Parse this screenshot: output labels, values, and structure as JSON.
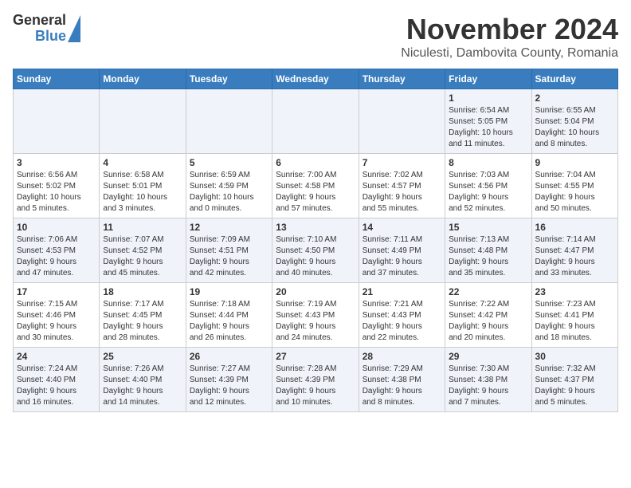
{
  "header": {
    "logo_general": "General",
    "logo_blue": "Blue",
    "title": "November 2024",
    "subtitle": "Niculesti, Dambovita County, Romania"
  },
  "weekdays": [
    "Sunday",
    "Monday",
    "Tuesday",
    "Wednesday",
    "Thursday",
    "Friday",
    "Saturday"
  ],
  "weeks": [
    [
      {
        "day": "",
        "info": ""
      },
      {
        "day": "",
        "info": ""
      },
      {
        "day": "",
        "info": ""
      },
      {
        "day": "",
        "info": ""
      },
      {
        "day": "",
        "info": ""
      },
      {
        "day": "1",
        "info": "Sunrise: 6:54 AM\nSunset: 5:05 PM\nDaylight: 10 hours\nand 11 minutes."
      },
      {
        "day": "2",
        "info": "Sunrise: 6:55 AM\nSunset: 5:04 PM\nDaylight: 10 hours\nand 8 minutes."
      }
    ],
    [
      {
        "day": "3",
        "info": "Sunrise: 6:56 AM\nSunset: 5:02 PM\nDaylight: 10 hours\nand 5 minutes."
      },
      {
        "day": "4",
        "info": "Sunrise: 6:58 AM\nSunset: 5:01 PM\nDaylight: 10 hours\nand 3 minutes."
      },
      {
        "day": "5",
        "info": "Sunrise: 6:59 AM\nSunset: 4:59 PM\nDaylight: 10 hours\nand 0 minutes."
      },
      {
        "day": "6",
        "info": "Sunrise: 7:00 AM\nSunset: 4:58 PM\nDaylight: 9 hours\nand 57 minutes."
      },
      {
        "day": "7",
        "info": "Sunrise: 7:02 AM\nSunset: 4:57 PM\nDaylight: 9 hours\nand 55 minutes."
      },
      {
        "day": "8",
        "info": "Sunrise: 7:03 AM\nSunset: 4:56 PM\nDaylight: 9 hours\nand 52 minutes."
      },
      {
        "day": "9",
        "info": "Sunrise: 7:04 AM\nSunset: 4:55 PM\nDaylight: 9 hours\nand 50 minutes."
      }
    ],
    [
      {
        "day": "10",
        "info": "Sunrise: 7:06 AM\nSunset: 4:53 PM\nDaylight: 9 hours\nand 47 minutes."
      },
      {
        "day": "11",
        "info": "Sunrise: 7:07 AM\nSunset: 4:52 PM\nDaylight: 9 hours\nand 45 minutes."
      },
      {
        "day": "12",
        "info": "Sunrise: 7:09 AM\nSunset: 4:51 PM\nDaylight: 9 hours\nand 42 minutes."
      },
      {
        "day": "13",
        "info": "Sunrise: 7:10 AM\nSunset: 4:50 PM\nDaylight: 9 hours\nand 40 minutes."
      },
      {
        "day": "14",
        "info": "Sunrise: 7:11 AM\nSunset: 4:49 PM\nDaylight: 9 hours\nand 37 minutes."
      },
      {
        "day": "15",
        "info": "Sunrise: 7:13 AM\nSunset: 4:48 PM\nDaylight: 9 hours\nand 35 minutes."
      },
      {
        "day": "16",
        "info": "Sunrise: 7:14 AM\nSunset: 4:47 PM\nDaylight: 9 hours\nand 33 minutes."
      }
    ],
    [
      {
        "day": "17",
        "info": "Sunrise: 7:15 AM\nSunset: 4:46 PM\nDaylight: 9 hours\nand 30 minutes."
      },
      {
        "day": "18",
        "info": "Sunrise: 7:17 AM\nSunset: 4:45 PM\nDaylight: 9 hours\nand 28 minutes."
      },
      {
        "day": "19",
        "info": "Sunrise: 7:18 AM\nSunset: 4:44 PM\nDaylight: 9 hours\nand 26 minutes."
      },
      {
        "day": "20",
        "info": "Sunrise: 7:19 AM\nSunset: 4:43 PM\nDaylight: 9 hours\nand 24 minutes."
      },
      {
        "day": "21",
        "info": "Sunrise: 7:21 AM\nSunset: 4:43 PM\nDaylight: 9 hours\nand 22 minutes."
      },
      {
        "day": "22",
        "info": "Sunrise: 7:22 AM\nSunset: 4:42 PM\nDaylight: 9 hours\nand 20 minutes."
      },
      {
        "day": "23",
        "info": "Sunrise: 7:23 AM\nSunset: 4:41 PM\nDaylight: 9 hours\nand 18 minutes."
      }
    ],
    [
      {
        "day": "24",
        "info": "Sunrise: 7:24 AM\nSunset: 4:40 PM\nDaylight: 9 hours\nand 16 minutes."
      },
      {
        "day": "25",
        "info": "Sunrise: 7:26 AM\nSunset: 4:40 PM\nDaylight: 9 hours\nand 14 minutes."
      },
      {
        "day": "26",
        "info": "Sunrise: 7:27 AM\nSunset: 4:39 PM\nDaylight: 9 hours\nand 12 minutes."
      },
      {
        "day": "27",
        "info": "Sunrise: 7:28 AM\nSunset: 4:39 PM\nDaylight: 9 hours\nand 10 minutes."
      },
      {
        "day": "28",
        "info": "Sunrise: 7:29 AM\nSunset: 4:38 PM\nDaylight: 9 hours\nand 8 minutes."
      },
      {
        "day": "29",
        "info": "Sunrise: 7:30 AM\nSunset: 4:38 PM\nDaylight: 9 hours\nand 7 minutes."
      },
      {
        "day": "30",
        "info": "Sunrise: 7:32 AM\nSunset: 4:37 PM\nDaylight: 9 hours\nand 5 minutes."
      }
    ]
  ]
}
